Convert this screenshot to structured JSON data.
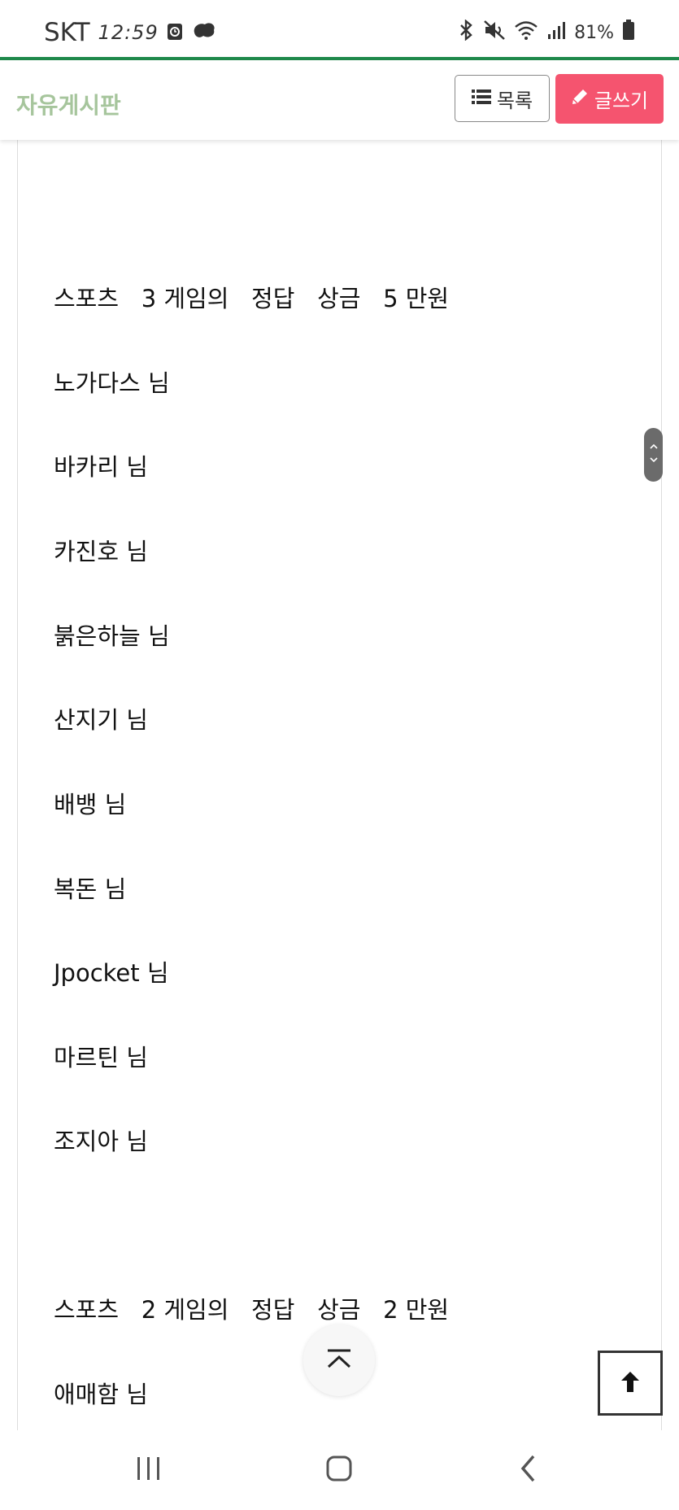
{
  "status_bar": {
    "carrier": "SKT",
    "time": "12:59",
    "battery": "81%"
  },
  "header": {
    "board_title": "자유게시판",
    "list_button": "목록",
    "write_button": "글쓰기"
  },
  "post": {
    "lines": [
      "스포츠   3 게임의   정답   상금   5 만원",
      "노가다스 님",
      "바카리 님",
      "카진호 님",
      "붉은하늘 님",
      "산지기 님",
      "배뱅 님",
      "복돈 님",
      "Jpocket 님",
      "마르틴 님",
      "조지아 님",
      "스포츠   2 게임의   정답   상금   2 만원",
      "애매함 님"
    ]
  },
  "colors": {
    "accent_green": "#1f8a4c",
    "title_green": "#a6c59c",
    "write_button_pink": "#f5546f"
  }
}
